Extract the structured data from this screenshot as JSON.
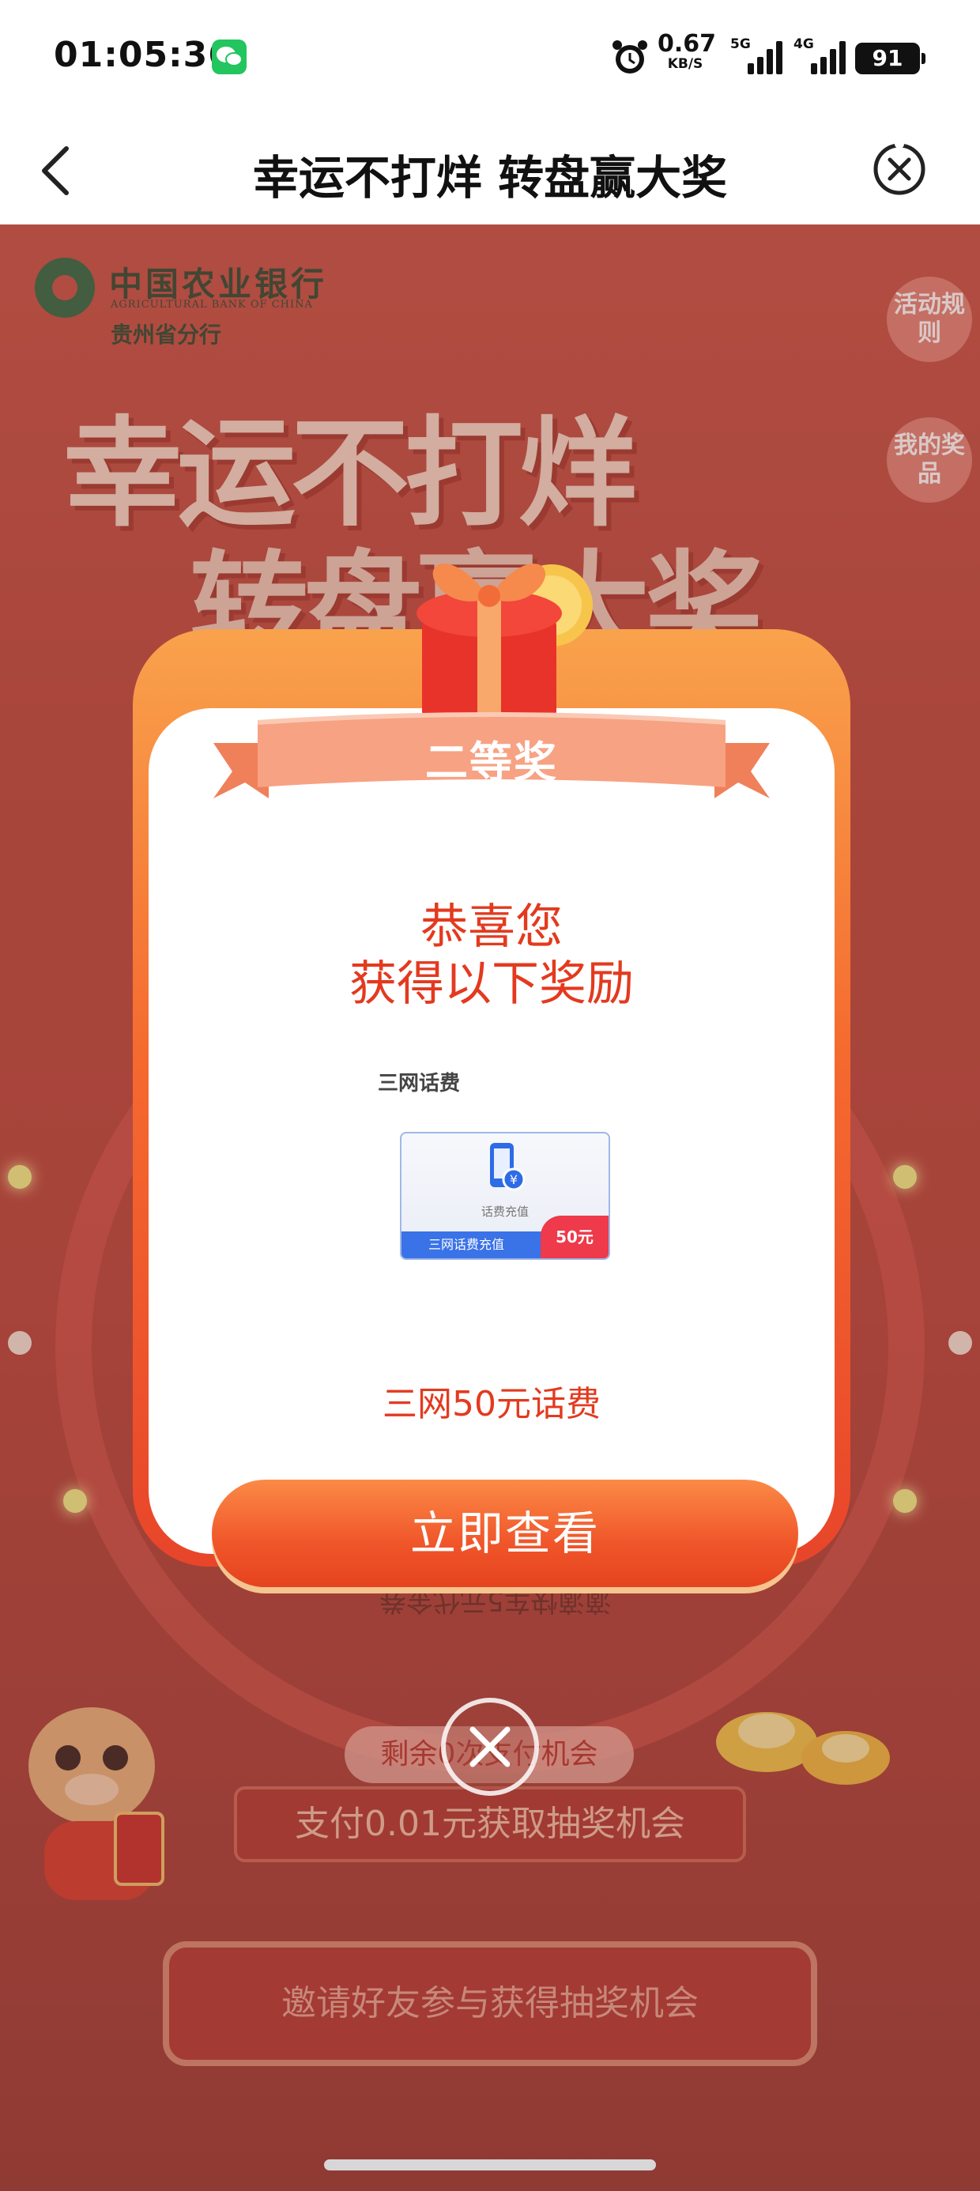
{
  "status_bar": {
    "time": "01:05:36",
    "net_speed_value": "0.67",
    "net_speed_unit": "KB/S",
    "signal_1_label": "5G",
    "signal_2_label": "4G",
    "battery": "91"
  },
  "nav": {
    "title": "幸运不打烊 转盘赢大奖"
  },
  "background": {
    "bank_name_cn": "中国农业银行",
    "bank_name_en": "AGRICULTURAL BANK OF CHINA",
    "bank_branch": "贵州省分行",
    "rules_label": "活动规则",
    "my_prizes_label": "我的奖品",
    "hero_line1": "幸运不打烊",
    "hero_line2": "转盘赢大奖",
    "wheel_prize_text": "滴滴快车5元代金券",
    "remaining_chances": "剩余0次支付机会",
    "pay_banner": "支付0.01元获取抽奖机会",
    "invite_banner": "邀请好友参与获得抽奖机会"
  },
  "modal": {
    "ribbon_label": "二等奖",
    "congrats_line1": "恭喜您",
    "congrats_line2": "获得以下奖励",
    "prize_category": "三网话费",
    "card_small_text": "话费充值",
    "card_footer": "三网话费充值",
    "card_amount": "50元",
    "prize_name": "三网50元话费",
    "view_button": "立即查看"
  },
  "colors": {
    "accent": "#e33a1f",
    "button": "#f0552a",
    "page_bg": "#bd4a3e"
  }
}
